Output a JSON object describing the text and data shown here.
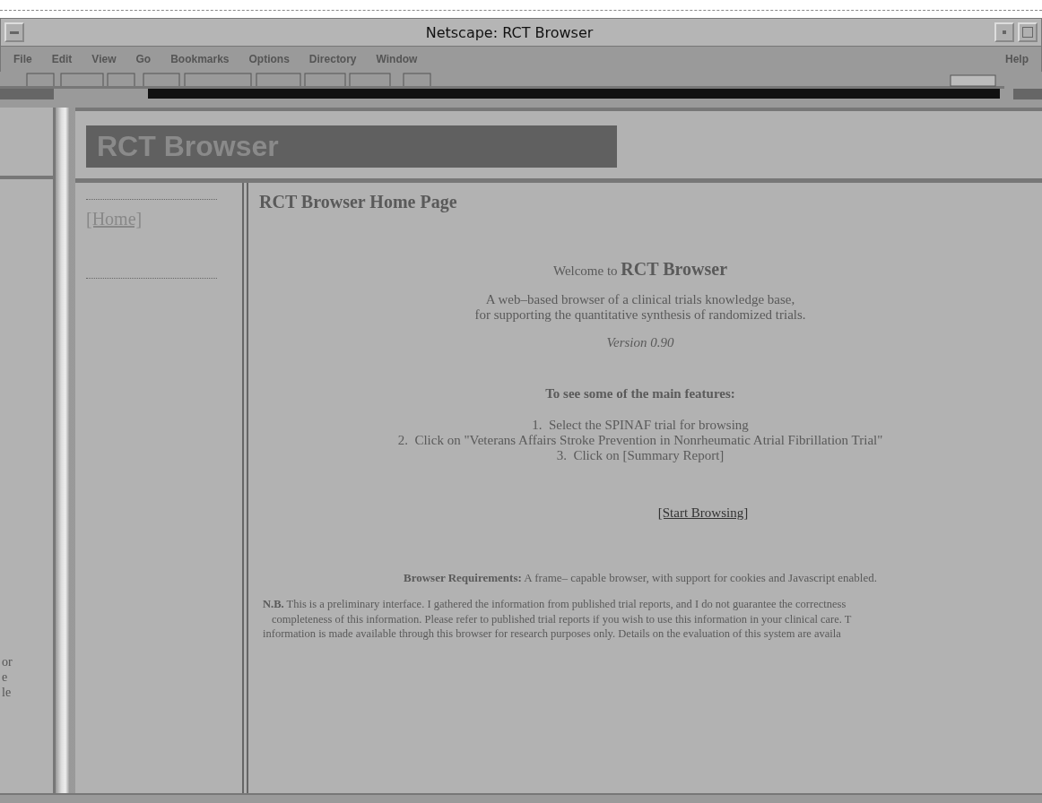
{
  "window": {
    "title": "Netscape: RCT Browser"
  },
  "menu": [
    {
      "label": "File"
    },
    {
      "label": "Edit"
    },
    {
      "label": "View"
    },
    {
      "label": "Go"
    },
    {
      "label": "Bookmarks"
    },
    {
      "label": "Options"
    },
    {
      "label": "Directory"
    },
    {
      "label": "Window"
    }
  ],
  "help_menu": {
    "label": "Help"
  },
  "left_frame": {
    "fragments": [
      "or",
      "e",
      "le"
    ]
  },
  "banner": {
    "title": "RCT Browser"
  },
  "nav": {
    "links": [
      {
        "label": "[Home]"
      }
    ]
  },
  "content": {
    "heading": "RCT Browser Home Page",
    "welcome": "Welcome to **RCT Browser**",
    "tagline": [
      "A web–based browser of a clinical trials knowledge base,",
      "for supporting the quantitative synthesis of randomized trials."
    ],
    "version": "Version 0.90",
    "features_heading": "To see some of the main features:",
    "steps": [
      "1.  Select the SPINAF trial for browsing",
      "2.  Click on \"Veterans Affairs Stroke Prevention in Nonrheumatic Atrial Fibrillation Trial\"",
      "3.  Click on [Summary Report]"
    ],
    "start_link": "[Start Browsing]",
    "requirements": "**Browser Requirements:** A frame– capable browser, with support for cookies and Javascript enabled.",
    "note_lines": [
      "**N.B.** This is a preliminary interface. I gathered the information from published trial reports, and I do not guarantee the correctness",
      "completeness of this information. Please refer to published trial reports if you wish to use this information in your clinical care. T",
      "information is made available through this browser for research purposes only. Details on the evaluation of this system are availa"
    ]
  }
}
